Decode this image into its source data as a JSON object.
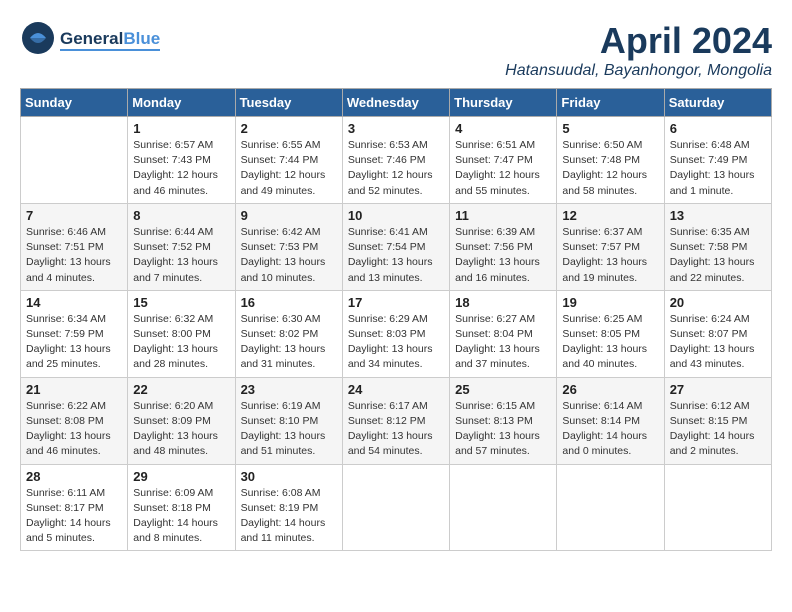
{
  "header": {
    "logo_line1": "General",
    "logo_line2": "Blue",
    "title": "April 2024",
    "location": "Hatansuudal, Bayanhongor, Mongolia"
  },
  "days_of_week": [
    "Sunday",
    "Monday",
    "Tuesday",
    "Wednesday",
    "Thursday",
    "Friday",
    "Saturday"
  ],
  "weeks": [
    [
      {
        "day": "",
        "info": ""
      },
      {
        "day": "1",
        "info": "Sunrise: 6:57 AM\nSunset: 7:43 PM\nDaylight: 12 hours\nand 46 minutes."
      },
      {
        "day": "2",
        "info": "Sunrise: 6:55 AM\nSunset: 7:44 PM\nDaylight: 12 hours\nand 49 minutes."
      },
      {
        "day": "3",
        "info": "Sunrise: 6:53 AM\nSunset: 7:46 PM\nDaylight: 12 hours\nand 52 minutes."
      },
      {
        "day": "4",
        "info": "Sunrise: 6:51 AM\nSunset: 7:47 PM\nDaylight: 12 hours\nand 55 minutes."
      },
      {
        "day": "5",
        "info": "Sunrise: 6:50 AM\nSunset: 7:48 PM\nDaylight: 12 hours\nand 58 minutes."
      },
      {
        "day": "6",
        "info": "Sunrise: 6:48 AM\nSunset: 7:49 PM\nDaylight: 13 hours\nand 1 minute."
      }
    ],
    [
      {
        "day": "7",
        "info": "Sunrise: 6:46 AM\nSunset: 7:51 PM\nDaylight: 13 hours\nand 4 minutes."
      },
      {
        "day": "8",
        "info": "Sunrise: 6:44 AM\nSunset: 7:52 PM\nDaylight: 13 hours\nand 7 minutes."
      },
      {
        "day": "9",
        "info": "Sunrise: 6:42 AM\nSunset: 7:53 PM\nDaylight: 13 hours\nand 10 minutes."
      },
      {
        "day": "10",
        "info": "Sunrise: 6:41 AM\nSunset: 7:54 PM\nDaylight: 13 hours\nand 13 minutes."
      },
      {
        "day": "11",
        "info": "Sunrise: 6:39 AM\nSunset: 7:56 PM\nDaylight: 13 hours\nand 16 minutes."
      },
      {
        "day": "12",
        "info": "Sunrise: 6:37 AM\nSunset: 7:57 PM\nDaylight: 13 hours\nand 19 minutes."
      },
      {
        "day": "13",
        "info": "Sunrise: 6:35 AM\nSunset: 7:58 PM\nDaylight: 13 hours\nand 22 minutes."
      }
    ],
    [
      {
        "day": "14",
        "info": "Sunrise: 6:34 AM\nSunset: 7:59 PM\nDaylight: 13 hours\nand 25 minutes."
      },
      {
        "day": "15",
        "info": "Sunrise: 6:32 AM\nSunset: 8:00 PM\nDaylight: 13 hours\nand 28 minutes."
      },
      {
        "day": "16",
        "info": "Sunrise: 6:30 AM\nSunset: 8:02 PM\nDaylight: 13 hours\nand 31 minutes."
      },
      {
        "day": "17",
        "info": "Sunrise: 6:29 AM\nSunset: 8:03 PM\nDaylight: 13 hours\nand 34 minutes."
      },
      {
        "day": "18",
        "info": "Sunrise: 6:27 AM\nSunset: 8:04 PM\nDaylight: 13 hours\nand 37 minutes."
      },
      {
        "day": "19",
        "info": "Sunrise: 6:25 AM\nSunset: 8:05 PM\nDaylight: 13 hours\nand 40 minutes."
      },
      {
        "day": "20",
        "info": "Sunrise: 6:24 AM\nSunset: 8:07 PM\nDaylight: 13 hours\nand 43 minutes."
      }
    ],
    [
      {
        "day": "21",
        "info": "Sunrise: 6:22 AM\nSunset: 8:08 PM\nDaylight: 13 hours\nand 46 minutes."
      },
      {
        "day": "22",
        "info": "Sunrise: 6:20 AM\nSunset: 8:09 PM\nDaylight: 13 hours\nand 48 minutes."
      },
      {
        "day": "23",
        "info": "Sunrise: 6:19 AM\nSunset: 8:10 PM\nDaylight: 13 hours\nand 51 minutes."
      },
      {
        "day": "24",
        "info": "Sunrise: 6:17 AM\nSunset: 8:12 PM\nDaylight: 13 hours\nand 54 minutes."
      },
      {
        "day": "25",
        "info": "Sunrise: 6:15 AM\nSunset: 8:13 PM\nDaylight: 13 hours\nand 57 minutes."
      },
      {
        "day": "26",
        "info": "Sunrise: 6:14 AM\nSunset: 8:14 PM\nDaylight: 14 hours\nand 0 minutes."
      },
      {
        "day": "27",
        "info": "Sunrise: 6:12 AM\nSunset: 8:15 PM\nDaylight: 14 hours\nand 2 minutes."
      }
    ],
    [
      {
        "day": "28",
        "info": "Sunrise: 6:11 AM\nSunset: 8:17 PM\nDaylight: 14 hours\nand 5 minutes."
      },
      {
        "day": "29",
        "info": "Sunrise: 6:09 AM\nSunset: 8:18 PM\nDaylight: 14 hours\nand 8 minutes."
      },
      {
        "day": "30",
        "info": "Sunrise: 6:08 AM\nSunset: 8:19 PM\nDaylight: 14 hours\nand 11 minutes."
      },
      {
        "day": "",
        "info": ""
      },
      {
        "day": "",
        "info": ""
      },
      {
        "day": "",
        "info": ""
      },
      {
        "day": "",
        "info": ""
      }
    ]
  ]
}
